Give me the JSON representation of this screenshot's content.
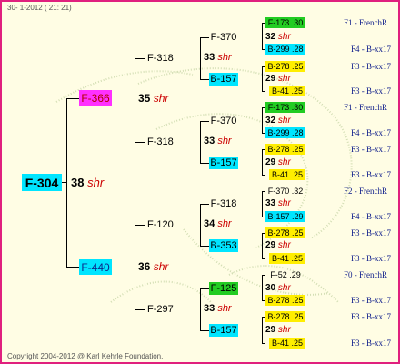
{
  "header": {
    "text": "30-  1-2012 ( 21: 21)"
  },
  "footer": {
    "text": "Copyright 2004-2012 @ Karl Kehrle Foundation."
  },
  "colors": {
    "border": "#e0207e",
    "background": "#fffde4",
    "cyan": "#00e5ff",
    "magenta": "#ff30ff",
    "green": "#22cc22",
    "yellow": "#ffee00",
    "shr": "#cc0000",
    "right_text": "#0b1a8a"
  },
  "root": {
    "id": "F-304",
    "num": "38",
    "tag": "shr"
  },
  "parents": [
    {
      "id": "F-366",
      "num": "35",
      "tag": "shr"
    },
    {
      "id": "F-440",
      "num": "36",
      "tag": "shr"
    }
  ],
  "grandparents": [
    {
      "id": "F-318",
      "num": "33",
      "tag": "shr"
    },
    {
      "id": "F-318",
      "num": "33",
      "tag": "shr"
    },
    {
      "id": "F-120",
      "num": "34",
      "tag": "shr"
    },
    {
      "id": "F-297",
      "num": "33",
      "tag": "shr"
    }
  ],
  "ggparents": [
    {
      "id": "F-370",
      "num": "32",
      "tag": "shr"
    },
    {
      "id": "B-157",
      "num": "29",
      "tag": "shr"
    },
    {
      "id": "F-370",
      "num": "32",
      "tag": "shr"
    },
    {
      "id": "B-157",
      "num": "29",
      "tag": "shr"
    },
    {
      "id": "F-318",
      "num": "33",
      "tag": "shr"
    },
    {
      "id": "B-353",
      "num": "29",
      "tag": "shr"
    },
    {
      "id": "F-125",
      "num": "30",
      "tag": "shr"
    },
    {
      "id": "B-157",
      "num": "29",
      "tag": "shr"
    }
  ],
  "gggparents": [
    {
      "id": "F-173  .30",
      "right": "F1 - FrenchR"
    },
    {
      "id": "B-299  .28",
      "right": "F4 - B-xx17"
    },
    {
      "id": "B-278  .25",
      "right": "F3 - B-xx17"
    },
    {
      "id": "B-41  .25",
      "right": "F3 - B-xx17"
    },
    {
      "id": "F-173  .30",
      "right": "F1 - FrenchR"
    },
    {
      "id": "B-299  .28",
      "right": "F4 - B-xx17"
    },
    {
      "id": "B-278  .25",
      "right": "F3 - B-xx17"
    },
    {
      "id": "B-41  .25",
      "right": "F3 - B-xx17"
    },
    {
      "id": "F-370  .32",
      "right": "F2 - FrenchR"
    },
    {
      "id": "B-157  .29",
      "right": "F4 - B-xx17"
    },
    {
      "id": "B-278  .25",
      "right": "F3 - B-xx17"
    },
    {
      "id": "B-41  .25",
      "right": "F3 - B-xx17"
    },
    {
      "id": "F-52  .29",
      "right": "F0 - FrenchR"
    },
    {
      "id": "B-278  .25",
      "right": "F3 - B-xx17"
    },
    {
      "id": "B-278  .25",
      "right": "F3 - B-xx17"
    },
    {
      "id": "B-41  .25",
      "right": "F3 - B-xx17"
    }
  ]
}
